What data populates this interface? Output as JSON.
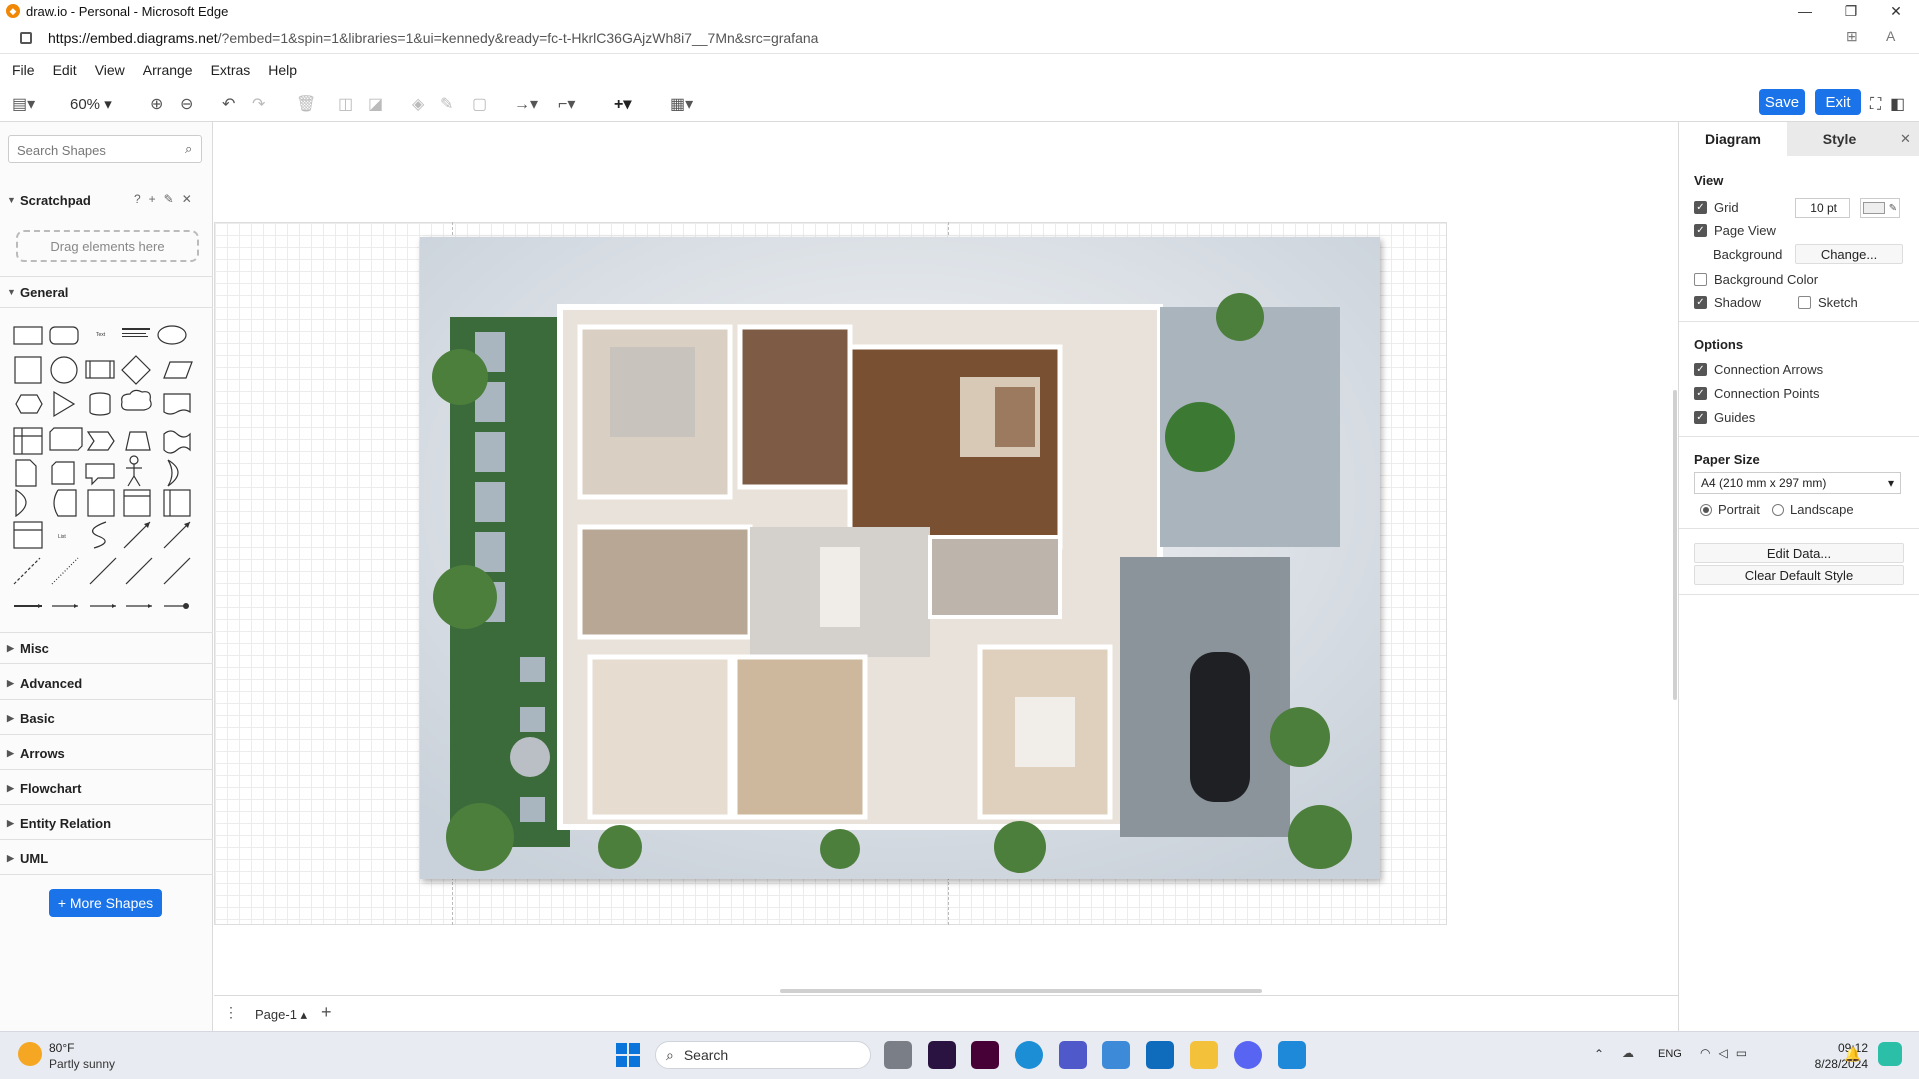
{
  "window": {
    "title": "draw.io - Personal - Microsoft Edge"
  },
  "browser": {
    "url_host": "https://embed.diagrams.net",
    "url_rest": "/?embed=1&spin=1&libraries=1&ui=kennedy&ready=fc-t-HkrlC36GAjzWh8i7__7Mn&src=grafana"
  },
  "menu": [
    "File",
    "Edit",
    "View",
    "Arrange",
    "Extras",
    "Help"
  ],
  "toolbar": {
    "zoom": "60%",
    "save": "Save",
    "exit": "Exit"
  },
  "sidebar": {
    "search_placeholder": "Search Shapes",
    "scratchpad": "Scratchpad",
    "dropzone": "Drag elements here",
    "general": "General",
    "sections": [
      "Misc",
      "Advanced",
      "Basic",
      "Arrows",
      "Flowchart",
      "Entity Relation",
      "UML"
    ],
    "more_shapes": "+ More Shapes"
  },
  "page_tab": "Page-1",
  "format_panel": {
    "tabs": [
      "Diagram",
      "Style"
    ],
    "view_heading": "View",
    "grid": "Grid",
    "grid_size": "10 pt",
    "page_view": "Page View",
    "background": "Background",
    "change": "Change...",
    "background_color": "Background Color",
    "shadow": "Shadow",
    "sketch": "Sketch",
    "options_heading": "Options",
    "connection_arrows": "Connection Arrows",
    "connection_points": "Connection Points",
    "guides": "Guides",
    "paper_heading": "Paper Size",
    "paper_size": "A4 (210 mm x 297 mm)",
    "portrait": "Portrait",
    "landscape": "Landscape",
    "edit_data": "Edit Data...",
    "clear_style": "Clear Default Style"
  },
  "taskbar": {
    "temp": "80°F",
    "weather": "Partly sunny",
    "search": "Search",
    "lang": "ENG",
    "time": "09:12",
    "date": "8/28/2024"
  }
}
